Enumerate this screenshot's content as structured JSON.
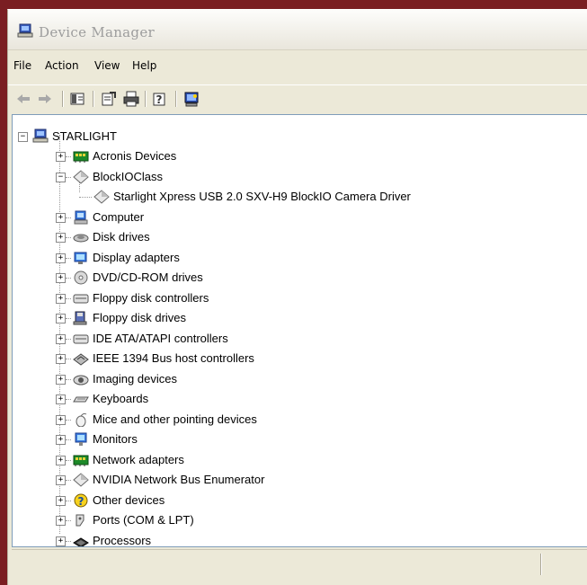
{
  "window": {
    "title": "Device Manager"
  },
  "menu": [
    {
      "label": "File"
    },
    {
      "label": "Action"
    },
    {
      "label": "View"
    },
    {
      "label": "Help"
    }
  ],
  "toolbar": [
    {
      "name": "back-arrow-icon"
    },
    {
      "name": "forward-arrow-icon"
    },
    {
      "name": "show-hide-console-tree-icon"
    },
    {
      "name": "properties-icon"
    },
    {
      "name": "print-icon"
    },
    {
      "name": "help-icon"
    },
    {
      "name": "scan-hardware-icon"
    }
  ],
  "tree": {
    "root": "STARLIGHT",
    "items": [
      {
        "label": "Acronis Devices",
        "icon": "network-adapter-icon",
        "expander": "+"
      },
      {
        "label": "BlockIOClass",
        "icon": "diamond-device-icon",
        "expander": "−"
      },
      {
        "label": "Starlight Xpress USB 2.0 SXV-H9 BlockIO Camera Driver",
        "icon": "diamond-device-icon",
        "expander": ""
      },
      {
        "label": "Computer",
        "icon": "computer-icon",
        "expander": "+"
      },
      {
        "label": "Disk drives",
        "icon": "disk-drive-icon",
        "expander": "+"
      },
      {
        "label": "Display adapters",
        "icon": "display-adapter-icon",
        "expander": "+"
      },
      {
        "label": "DVD/CD-ROM drives",
        "icon": "cd-drive-icon",
        "expander": "+"
      },
      {
        "label": "Floppy disk controllers",
        "icon": "controller-icon",
        "expander": "+"
      },
      {
        "label": "Floppy disk drives",
        "icon": "floppy-drive-icon",
        "expander": "+"
      },
      {
        "label": "IDE ATA/ATAPI controllers",
        "icon": "controller-icon",
        "expander": "+"
      },
      {
        "label": "IEEE 1394 Bus host controllers",
        "icon": "firewire-icon",
        "expander": "+"
      },
      {
        "label": "Imaging devices",
        "icon": "camera-icon",
        "expander": "+"
      },
      {
        "label": "Keyboards",
        "icon": "keyboard-icon",
        "expander": "+"
      },
      {
        "label": "Mice and other pointing devices",
        "icon": "mouse-icon",
        "expander": "+"
      },
      {
        "label": "Monitors",
        "icon": "monitor-icon",
        "expander": "+"
      },
      {
        "label": "Network adapters",
        "icon": "network-adapter-icon",
        "expander": "+"
      },
      {
        "label": "NVIDIA Network Bus Enumerator",
        "icon": "diamond-device-icon",
        "expander": "+"
      },
      {
        "label": "Other devices",
        "icon": "unknown-device-icon",
        "expander": "+"
      },
      {
        "label": "Ports (COM & LPT)",
        "icon": "port-icon",
        "expander": "+"
      },
      {
        "label": "Processors",
        "icon": "processor-icon",
        "expander": "+"
      }
    ]
  }
}
